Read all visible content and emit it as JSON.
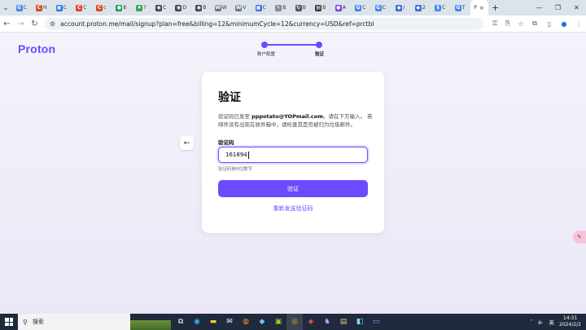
{
  "browser": {
    "tabs": [
      {
        "label": "C",
        "fav_color": "#4285f4",
        "fav_glyph": "G"
      },
      {
        "label": "H",
        "fav_color": "#e0452b",
        "fav_glyph": "C"
      },
      {
        "label": "C",
        "fav_color": "#1a73e8",
        "fav_glyph": "▦"
      },
      {
        "label": "C",
        "fav_color": "#e0452b",
        "fav_glyph": "C"
      },
      {
        "label": "c",
        "fav_color": "#e0452b",
        "fav_glyph": "C"
      },
      {
        "label": "8",
        "fav_color": "#1a9e48",
        "fav_glyph": "●"
      },
      {
        "label": "?",
        "fav_color": "#34a853",
        "fav_glyph": "♦"
      },
      {
        "label": "C",
        "fav_color": "#444444",
        "fav_glyph": "◉"
      },
      {
        "label": "D",
        "fav_color": "#444444",
        "fav_glyph": "◉"
      },
      {
        "label": "B",
        "fav_color": "#444444",
        "fav_glyph": "◉"
      },
      {
        "label": "W",
        "fav_color": "#777777",
        "fav_glyph": "W"
      },
      {
        "label": "V",
        "fav_color": "#777777",
        "fav_glyph": "W"
      },
      {
        "label": "C",
        "fav_color": "#4a6cf7",
        "fav_glyph": "▣"
      },
      {
        "label": "B",
        "fav_color": "#888888",
        "fav_glyph": "✎"
      },
      {
        "label": "B",
        "fav_color": "#555555",
        "fav_glyph": "↻"
      },
      {
        "label": "B",
        "fav_color": "#333333",
        "fav_glyph": "▤"
      },
      {
        "label": "A",
        "fav_color": "#7b3fe4",
        "fav_glyph": "●"
      },
      {
        "label": "C",
        "fav_color": "#4285f4",
        "fav_glyph": "G"
      },
      {
        "label": "C",
        "fav_color": "#4285f4",
        "fav_glyph": "G"
      },
      {
        "label": "/",
        "fav_color": "#3d6fd8",
        "fav_glyph": "◆"
      },
      {
        "label": "2",
        "fav_color": "#3d6fd8",
        "fav_glyph": "◆"
      },
      {
        "label": "C",
        "fav_color": "#4285f4",
        "fav_glyph": "§"
      },
      {
        "label": "T",
        "fav_color": "#4285f4",
        "fav_glyph": "G"
      }
    ],
    "active_tab": {
      "label": "P",
      "close": "×"
    },
    "new_tab": "+",
    "url": "account.proton.me/mail/signup?plan=free&billing=12&minimumCycle=12&currency=USD&ref=prctbl"
  },
  "page": {
    "logo": "Proton",
    "steps": [
      {
        "label": "账户配置"
      },
      {
        "label": "验证"
      }
    ],
    "card": {
      "title": "验证",
      "desc_prefix": "验证码已发至 ",
      "email": "pppotato@YOPmail.com",
      "desc_suffix": "。请在下方输入。 若邮件没有出现在收件箱中，请检查其是否被归为垃圾邮件。",
      "field_label": "验证码",
      "code_value": "161894",
      "hint": "验证码是6位数字",
      "submit_label": "验证",
      "resend_label": "重新发送验证码"
    }
  },
  "taskbar": {
    "search_placeholder": "搜索",
    "tray_lang": "英",
    "time": "14:31",
    "date": "2024/2/2"
  },
  "colors": {
    "brand": "#6d4aff",
    "taskbar": "#1f2a3c"
  }
}
